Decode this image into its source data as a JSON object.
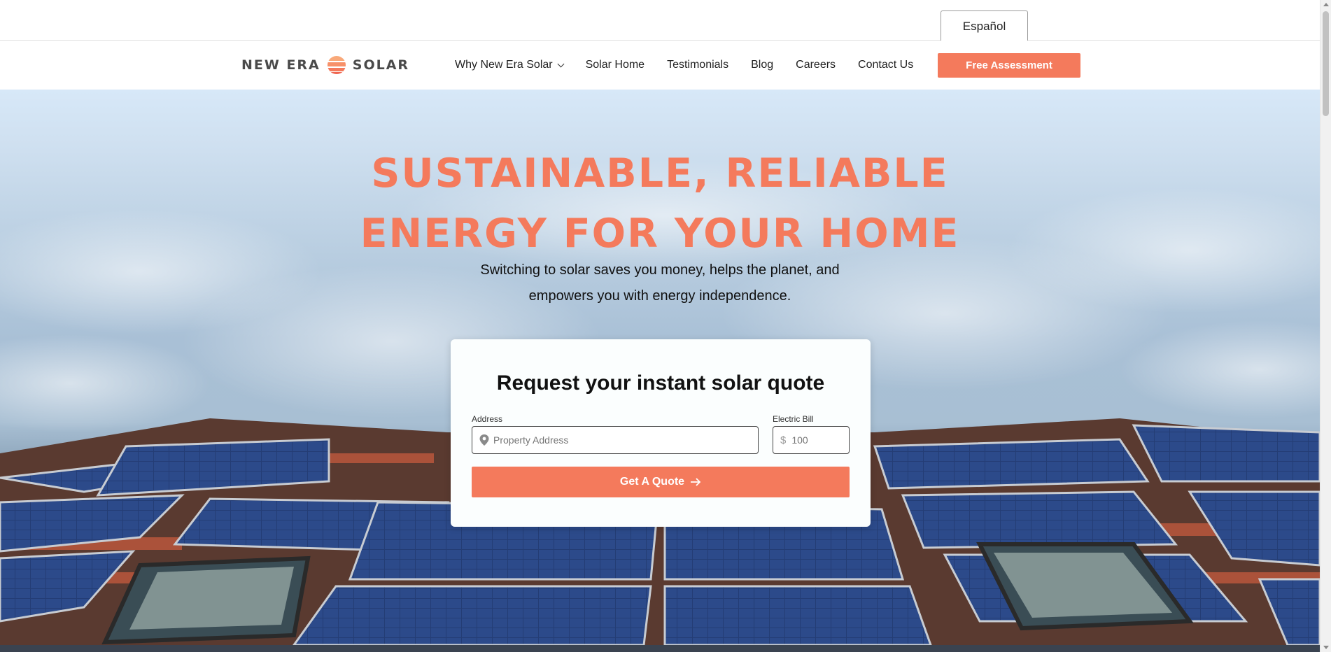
{
  "lang_bar": {
    "language_tab": "Español"
  },
  "header": {
    "logo": {
      "word1": "NEW ERA",
      "word2": "SOLAR",
      "sun_colors": [
        "#f9a97a",
        "#f7916a",
        "#f47a5c",
        "#ef6550"
      ]
    },
    "nav": [
      {
        "label": "Why New Era Solar",
        "has_dropdown": true
      },
      {
        "label": "Solar Home"
      },
      {
        "label": "Testimonials"
      },
      {
        "label": "Blog"
      },
      {
        "label": "Careers"
      },
      {
        "label": "Contact Us"
      }
    ],
    "cta": "Free Assessment"
  },
  "hero": {
    "title_line1": "SUSTAINABLE, RELIABLE",
    "title_line2": "ENERGY FOR YOUR HOME",
    "subtitle_line1": "Switching to solar saves you money, helps the planet, and",
    "subtitle_line2": "empowers you with energy independence."
  },
  "quote": {
    "title": "Request your instant solar quote",
    "address_label": "Address",
    "address_placeholder": "Property Address",
    "bill_label": "Electric Bill",
    "bill_currency": "$",
    "bill_placeholder": "100",
    "button": "Get A Quote",
    "button_icon": "arrow-right-icon"
  },
  "colors": {
    "accent": "#f47a5c",
    "title": "#f47a5c"
  }
}
